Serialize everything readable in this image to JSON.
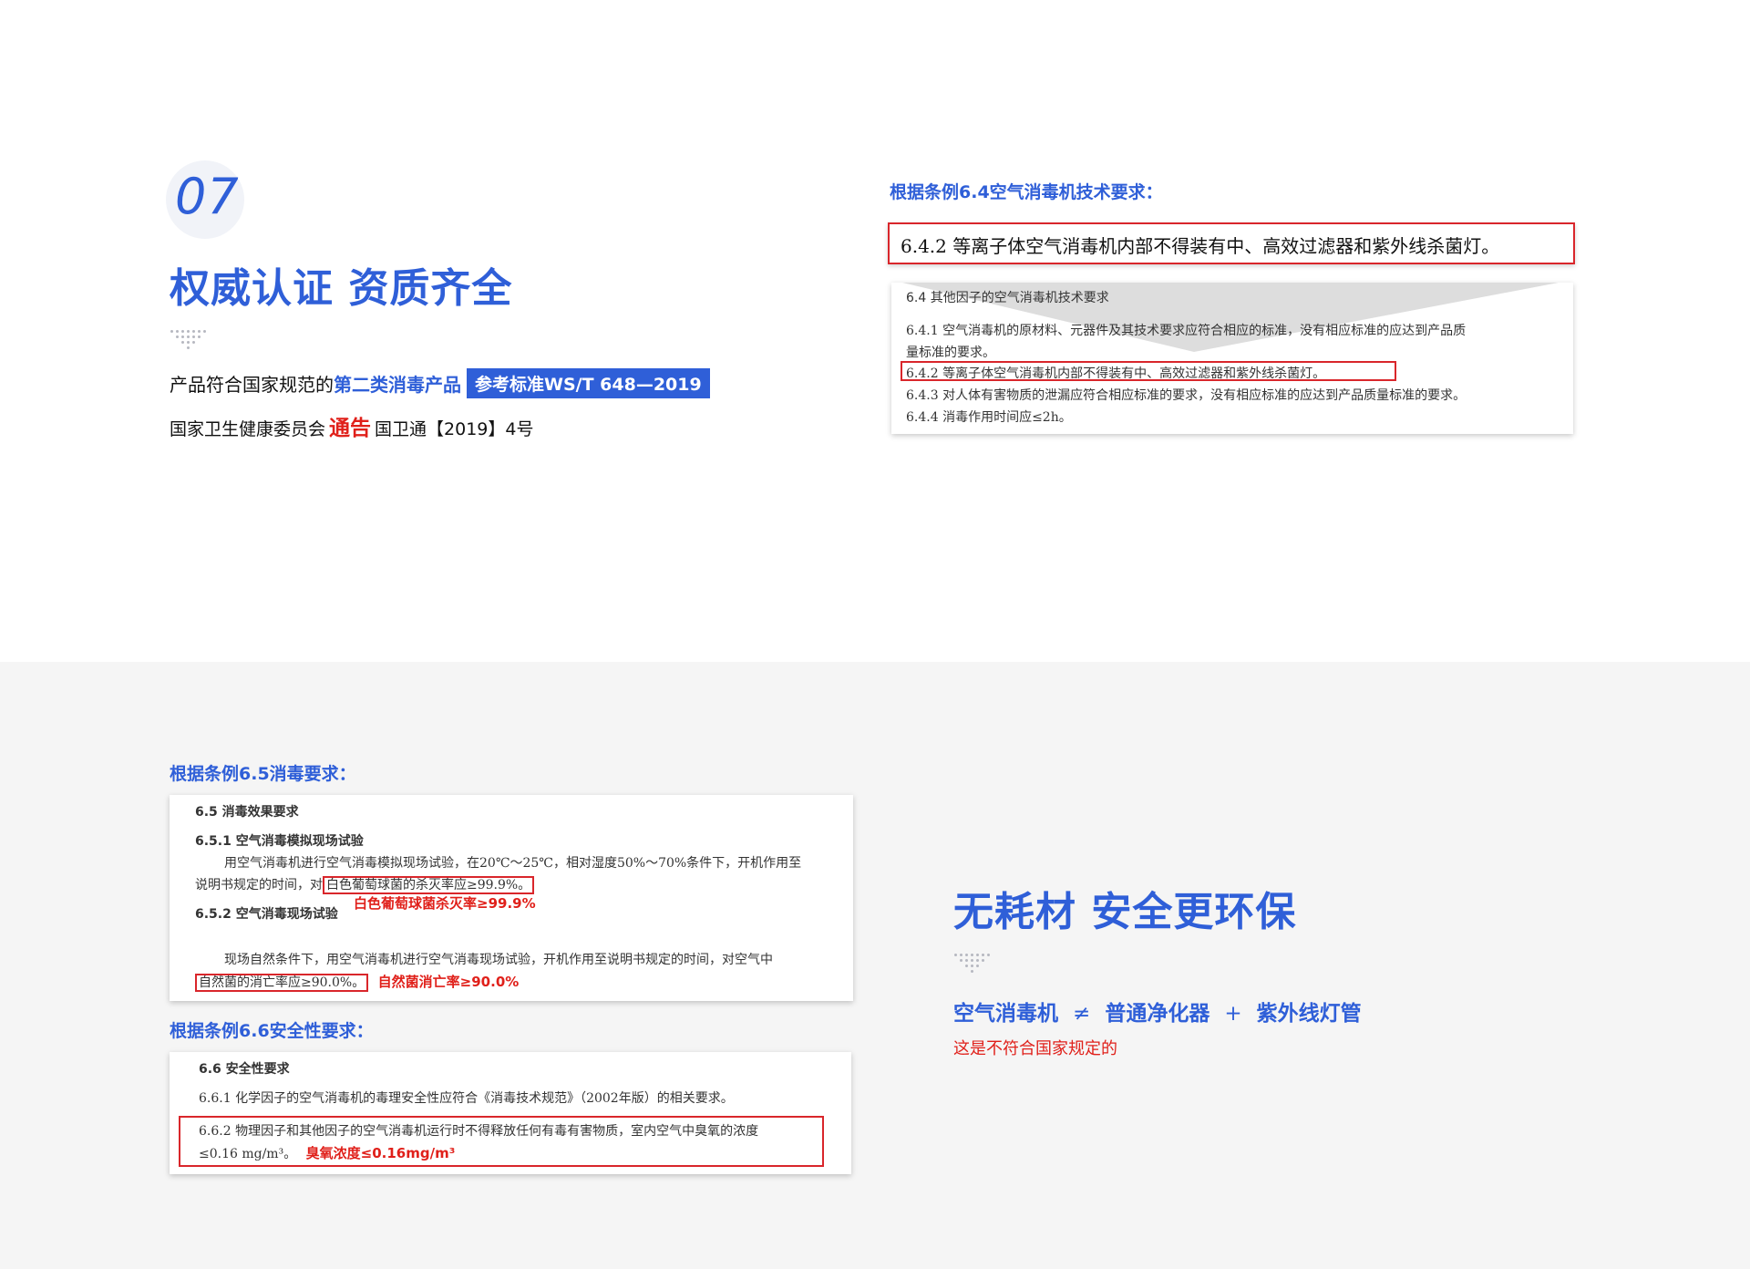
{
  "section": {
    "number": "07",
    "title": "权威认证 资质齐全",
    "line1_prefix": "产品符合国家规范的",
    "line1_highlight": "第二类消毒产品",
    "line1_badge": "参考标准WS/T 648—2019",
    "line2_prefix": "国家卫生健康委员会",
    "line2_notice": "通告",
    "line2_suffix": "国卫通【2019】4号"
  },
  "clause_64": {
    "label": "根据条例6.4空气消毒机技术要求：",
    "highlight": "6.4.2   等离子体空气消毒机内部不得装有中、高效过滤器和紫外线杀菌灯。",
    "heading": "6.4   其他因子的空气消毒机技术要求",
    "item_641_a": "6.4.1   空气消毒机的原材料、元器件及其技术要求应符合相应的标准，没有相应标准的应达到产品质",
    "item_641_b": "量标准的要求。",
    "item_642": "6.4.2   等离子体空气消毒机内部不得装有中、高效过滤器和紫外线杀菌灯。",
    "item_643": "6.4.3   对人体有害物质的泄漏应符合相应标准的要求，没有相应标准的应达到产品质量标准的要求。",
    "item_644": "6.4.4   消毒作用时间应≤2h。"
  },
  "clause_65": {
    "label": "根据条例6.5消毒要求：",
    "heading": "6.5  消毒效果要求",
    "item_651": "6.5.1   空气消毒模拟现场试验",
    "text_a": "用空气消毒机进行空气消毒模拟现场试验，在20℃～25℃，相对湿度50%～70%条件下，开机作用至",
    "text_b_prefix": "说明书规定的时间，对",
    "text_b_box": "白色葡萄球菌的杀灭率应≥99.9%。",
    "note_1": "白色葡萄球菌杀灭率≥99.9%",
    "item_652": "6.5.2   空气消毒现场试验",
    "text_c": "现场自然条件下，用空气消毒机进行空气消毒现场试验，开机作用至说明书规定的时间，对空气中",
    "text_d_box": "自然菌的消亡率应≥90.0%。",
    "note_2": "自然菌消亡率≥90.0%"
  },
  "clause_66": {
    "label": "根据条例6.6安全性要求：",
    "heading": "6.6   安全性要求",
    "item_661": "6.6.1   化学因子的空气消毒机的毒理安全性应符合《消毒技术规范》（2002年版）的相关要求。",
    "item_662_a": "6.6.2   物理因子和其他因子的空气消毒机运行时不得释放任何有毒有害物质，室内空气中臭氧的浓度",
    "item_662_b": "≤0.16 mg/m³。",
    "note_3": "臭氧浓度≤0.16mg/m³"
  },
  "right": {
    "title": "无耗材 安全更环保",
    "formula_a": "空气消毒机",
    "formula_op1": "≠",
    "formula_b": "普通净化器",
    "formula_op2": "+",
    "formula_c": "紫外线灯管",
    "warning": "这是不符合国家规定的"
  },
  "colors": {
    "accent": "#2f5fd8",
    "red": "#e0201a",
    "bottom_bg": "#f5f5f5"
  }
}
